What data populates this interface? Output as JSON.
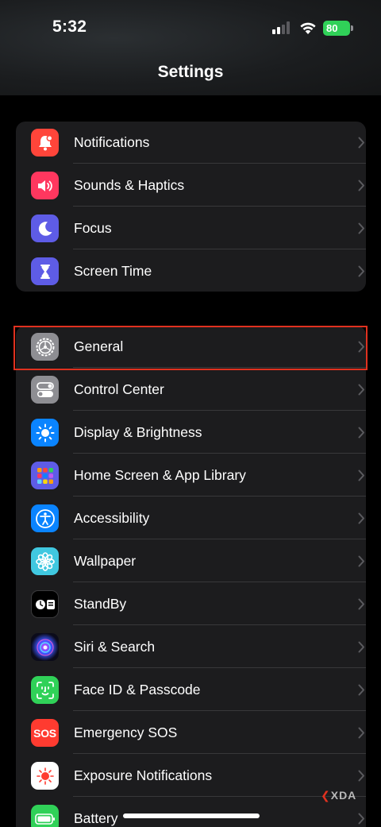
{
  "status_bar": {
    "time": "5:32",
    "battery_label": "80",
    "battery_percent": 80,
    "battery_color": "#30d158",
    "signal_icon": "cellular-signal-icon",
    "wifi_icon": "wifi-icon"
  },
  "header": {
    "title": "Settings"
  },
  "groups": [
    {
      "items": [
        {
          "label": "Notifications",
          "icon": "bell-icon",
          "color": "#ff453a"
        },
        {
          "label": "Sounds & Haptics",
          "icon": "speaker-icon",
          "color": "#ff375f"
        },
        {
          "label": "Focus",
          "icon": "moon-icon",
          "color": "#5e5ce6"
        },
        {
          "label": "Screen Time",
          "icon": "hourglass-icon",
          "color": "#5e5ce6"
        }
      ]
    },
    {
      "items": [
        {
          "label": "General",
          "icon": "gear-icon",
          "color": "#8e8e93",
          "highlighted": true
        },
        {
          "label": "Control Center",
          "icon": "toggles-icon",
          "color": "#8e8e93"
        },
        {
          "label": "Display & Brightness",
          "icon": "sun-icon",
          "color": "#0a84ff"
        },
        {
          "label": "Home Screen & App Library",
          "icon": "app-grid-icon",
          "color": "#5e5ce6"
        },
        {
          "label": "Accessibility",
          "icon": "accessibility-icon",
          "color": "#0a84ff"
        },
        {
          "label": "Wallpaper",
          "icon": "flower-icon",
          "color": "#40c8e0"
        },
        {
          "label": "StandBy",
          "icon": "standby-icon",
          "color": "#000000"
        },
        {
          "label": "Siri & Search",
          "icon": "siri-icon",
          "color": "#1c1c1e"
        },
        {
          "label": "Face ID & Passcode",
          "icon": "face-id-icon",
          "color": "#30d158"
        },
        {
          "label": "Emergency SOS",
          "icon": "sos-icon",
          "color": "#ff3b30",
          "icon_text": "SOS"
        },
        {
          "label": "Exposure Notifications",
          "icon": "exposure-icon",
          "color": "#ffffff"
        },
        {
          "label": "Battery",
          "icon": "battery-app-icon",
          "color": "#30d158"
        }
      ]
    }
  ],
  "watermark": "XDA"
}
